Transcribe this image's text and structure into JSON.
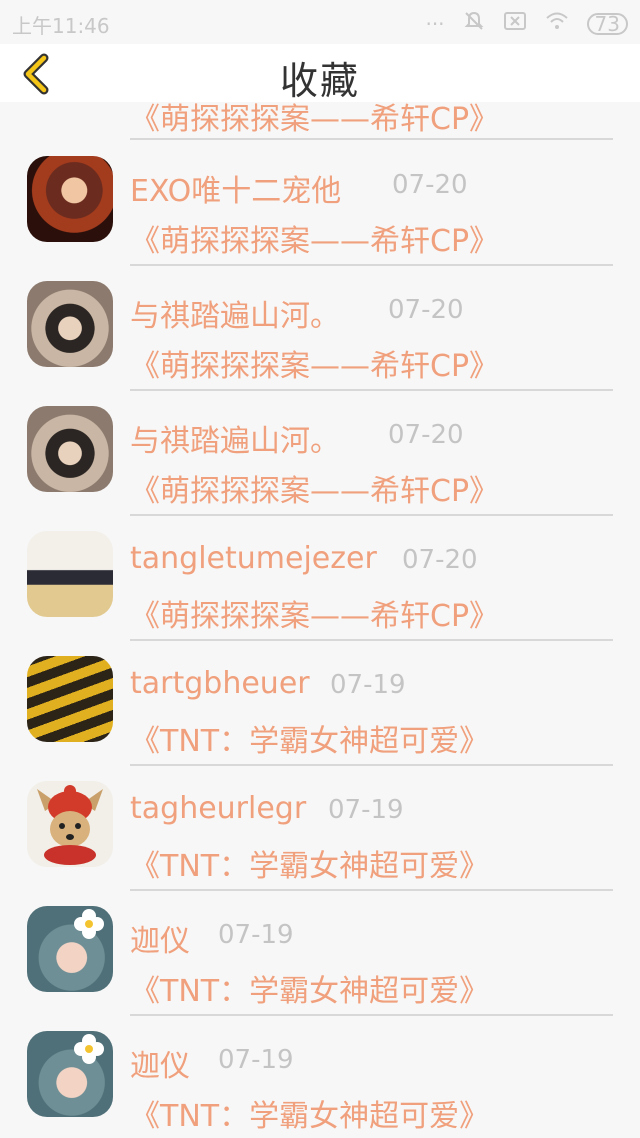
{
  "status_bar": {
    "time": "上午11:46",
    "battery": "73"
  },
  "header": {
    "title": "收藏",
    "back_icon": "chevron-left-icon"
  },
  "partial_top": {
    "book": "《萌探探探案——希轩CP》"
  },
  "items": [
    {
      "user": "EXO唯十二宠他",
      "date": "07-20",
      "book": "《萌探探探案——希轩CP》"
    },
    {
      "user": "与祺踏遍山河。",
      "date": "07-20",
      "book": "《萌探探探案——希轩CP》"
    },
    {
      "user": "与祺踏遍山河。",
      "date": "07-20",
      "book": "《萌探探探案——希轩CP》"
    },
    {
      "user": "tangletumejezer",
      "date": "07-20",
      "book": "《萌探探探案——希轩CP》"
    },
    {
      "user": "tartgbheuer",
      "date": "07-19",
      "book": "《TNT：学霸女神超可爱》"
    },
    {
      "user": "tagheurlegr",
      "date": "07-19",
      "book": "《TNT：学霸女神超可爱》"
    },
    {
      "user": "迦仪",
      "date": "07-19",
      "book": "《TNT：学霸女神超可爱》"
    },
    {
      "user": "迦仪",
      "date": "07-19",
      "book": "《TNT：学霸女神超可爱》"
    }
  ]
}
